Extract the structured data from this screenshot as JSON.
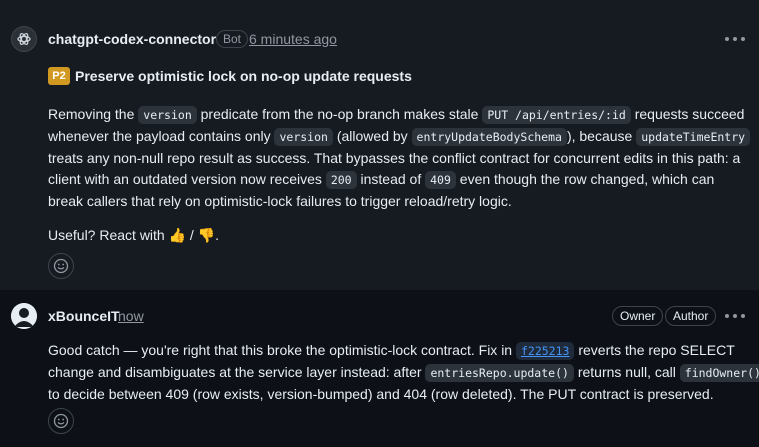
{
  "comment1": {
    "author": "chatgpt-codex-connector",
    "badge": "Bot",
    "time": "6 minutes ago",
    "priority": "P2",
    "title": "Preserve optimistic lock on no-op update requests",
    "p1": {
      "l1a": "Removing the ",
      "c_version": "version",
      "l1b": " predicate from the no-op branch makes stale ",
      "c_put": "PUT /api/entries/:id",
      "l1c": " requests succeed",
      "l2a": "whenever the payload contains only ",
      "c_version2": "version",
      "l2b": " (allowed by ",
      "c_schema": "entryUpdateBodySchema",
      "l2c": "), because ",
      "c_update": "updateTimeEntry",
      "l3": "treats any non-null repo result as success. That bypasses the conflict contract for concurrent edits in this path: a",
      "l4a": "client with an outdated version now receives ",
      "c_200": "200",
      "l4b": " instead of ",
      "c_409": "409",
      "l4c": " even though the row changed, which can",
      "l5": "break callers that rely on optimistic-lock failures to trigger reload/retry logic."
    },
    "useful_a": "Useful? React with ",
    "thumbs_up": "👍",
    "slash": " / ",
    "thumbs_down": "👎",
    "period": "."
  },
  "comment2": {
    "author": "xBounceIT",
    "time": "now",
    "owner_label": "Owner",
    "author_label": "Author",
    "p": {
      "l1a": "Good catch — you're right that this broke the optimistic-lock contract. Fix in ",
      "sha": "f225213",
      "l1b": " reverts the repo SELECT",
      "l2a": "change and disambiguates at the service layer instead: after ",
      "c_repo": "entriesRepo.update()",
      "l2b": " returns null, call ",
      "c_find": "findOwner()",
      "l3": "to decide between 409 (row exists, version-bumped) and 404 (row deleted). The PUT contract is preserved."
    }
  },
  "icons": [
    "openai-logo-icon",
    "user-avatar-icon",
    "smiley-icon",
    "kebab-menu-icon"
  ]
}
